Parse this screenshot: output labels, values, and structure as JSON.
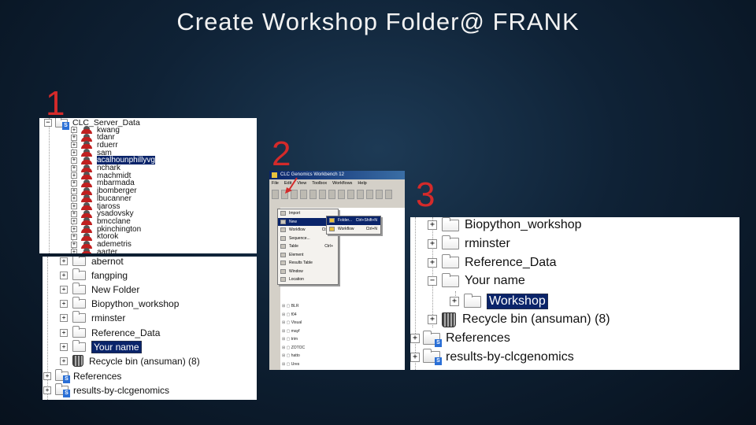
{
  "slide": {
    "title": "Create Workshop Folder@ FRANK"
  },
  "steps": [
    "1",
    "2",
    "3"
  ],
  "colors": {
    "step_number": "#d42a2a",
    "selection": "#0a246a",
    "background": "#0f2236"
  },
  "panel1_top": {
    "root": "CLC_Server_Data",
    "users": [
      "kwang",
      "tdanr",
      "rduerr",
      "sam",
      "acalhounphillyvg",
      "nchark",
      "machmidt",
      "mbarmada",
      "jbomberger",
      "lbucanner",
      "tjaross",
      "ysadovsky",
      "bmcclane",
      "pkinchington",
      "ktorok",
      "ademetris",
      "aarter"
    ]
  },
  "panel1_bottom": {
    "items": [
      "abernot",
      "fangping",
      "New Folder",
      "Biopython_workshop",
      "rminster",
      "Reference_Data",
      "Your name",
      "Recycle bin (ansuman) (8)"
    ],
    "roots": [
      "References",
      "results-by-clcgenomics"
    ]
  },
  "panel2": {
    "window_title": "CLC Genomics Workbench 12",
    "menubar": [
      "File",
      "Edit",
      "View",
      "Toolbox",
      "Workflows",
      "Help"
    ],
    "file_menu": [
      {
        "label": "Import",
        "shortcut": ""
      },
      {
        "label": "New",
        "shortcut": ""
      },
      {
        "label": "Workflow",
        "shortcut": "Ctrl+N"
      },
      {
        "label": "Sequence...",
        "shortcut": ""
      },
      {
        "label": "Table",
        "shortcut": "Ctrl+"
      },
      {
        "label": "Element",
        "shortcut": ""
      },
      {
        "label": "Results Table",
        "shortcut": ""
      },
      {
        "label": "Window",
        "shortcut": ""
      },
      {
        "label": "Location",
        "shortcut": ""
      }
    ],
    "new_submenu": [
      {
        "label": "Folder...",
        "shortcut": "Ctrl+Shift+N"
      },
      {
        "label": "Workflow",
        "shortcut": "Ctrl+N"
      }
    ],
    "side_tree": [
      "BLR",
      "f04",
      "Visual",
      "mayf",
      "trim",
      "ZOTOC",
      "hatto",
      "Ures",
      "scas",
      "oser"
    ]
  },
  "panel3": {
    "items": [
      "Biopython_workshop",
      "rminster",
      "Reference_Data",
      "Your name"
    ],
    "child": "Workshop",
    "recycle": "Recycle bin (ansuman) (8)",
    "roots": [
      "References",
      "results-by-clcgenomics"
    ]
  }
}
